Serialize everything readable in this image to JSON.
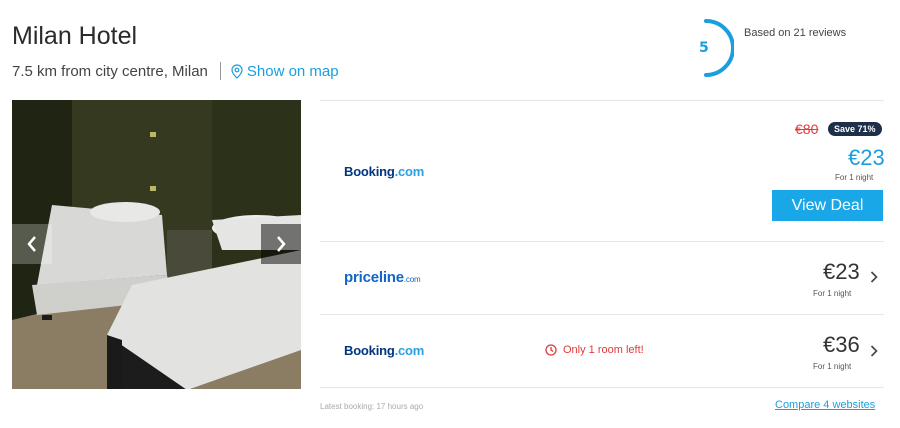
{
  "hotel": {
    "name": "Milan Hotel",
    "distance": "7.5 km from city centre, Milan",
    "map_link": "Show on map"
  },
  "rating": {
    "score": "5",
    "reviews": "Based on 21 reviews"
  },
  "gallery": {
    "prev_icon": "chevron-left-icon",
    "next_icon": "chevron-right-icon"
  },
  "deals": [
    {
      "provider_main": "Booking",
      "provider_suffix": ".com",
      "old_price": "€80",
      "save_badge": "Save 71%",
      "price": "€23",
      "per_night": "For 1 night",
      "cta": "View Deal"
    },
    {
      "provider_main": "priceline",
      "provider_suffix": ".com",
      "price": "€23",
      "per_night": "For 1 night"
    },
    {
      "provider_main": "Booking",
      "provider_suffix": ".com",
      "urgency": "Only 1 room left!",
      "price": "€36",
      "per_night": "For 1 night"
    }
  ],
  "footer": {
    "latest_booking": "Latest booking: 17 hours ago",
    "compare_link": "Compare 4 websites"
  },
  "colors": {
    "accent": "#1a9ee0",
    "cta": "#1aa7e8",
    "alert": "#e03a3a",
    "badge": "#1d2f4a"
  }
}
